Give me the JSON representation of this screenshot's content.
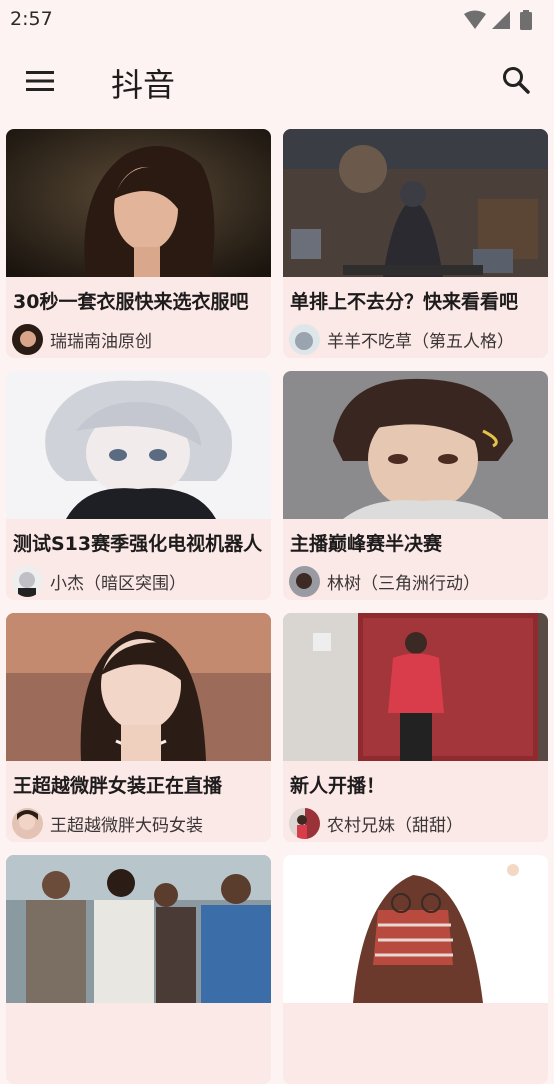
{
  "status_bar": {
    "time": "2:57",
    "icons": [
      "wifi-icon",
      "cellular-signal-icon",
      "battery-icon"
    ]
  },
  "app_bar": {
    "title": "抖音",
    "menu_icon": "hamburger-menu-icon",
    "search_icon": "search-icon"
  },
  "colors": {
    "background": "#fdf3f2",
    "card_background": "#fbe9e7",
    "title_text": "#1d1b1c",
    "author_text": "#3b3536"
  },
  "feed": {
    "cards": [
      {
        "title": "30秒一套衣服快来选衣服吧",
        "author": "瑞瑞南油原创"
      },
      {
        "title": "单排上不去分？快来看看吧",
        "author": "羊羊不吃草（第五人格）"
      },
      {
        "title": "测试S13赛季强化电视机器人",
        "author": "小杰（暗区突围）"
      },
      {
        "title": "主播巅峰赛半决赛",
        "author": "林树（三角洲行动）"
      },
      {
        "title": "王超越微胖女装正在直播",
        "author": "王超越微胖大码女装"
      },
      {
        "title": "新人开播！",
        "author": "农村兄妹（甜甜）"
      },
      {
        "title": "",
        "author": ""
      },
      {
        "title": "",
        "author": ""
      }
    ]
  }
}
